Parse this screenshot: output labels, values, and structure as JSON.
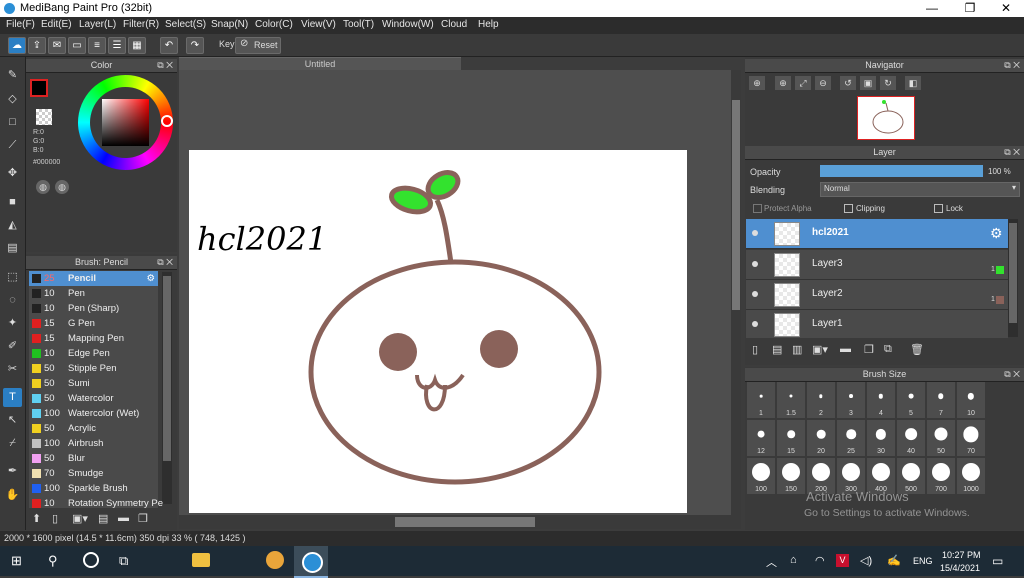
{
  "window": {
    "title": "MediBang Paint Pro (32bit)",
    "minimize": "—",
    "maximize": "❐",
    "close": "✕"
  },
  "menu": [
    "File(F)",
    "Edit(E)",
    "Layer(L)",
    "Filter(R)",
    "Select(S)",
    "Snap(N)",
    "Color(C)",
    "View(V)",
    "Tool(T)",
    "Window(W)",
    "Cloud",
    "Help"
  ],
  "toolbar": {
    "key_label": "Key",
    "reset_label": "Reset"
  },
  "color_panel": {
    "title": "Color",
    "r": "R:0",
    "g": "G:0",
    "b": "B:0",
    "hex": "#000000",
    "foreground": "#000000"
  },
  "brush_panel": {
    "title": "Brush: Pencil",
    "items": [
      {
        "size": "25",
        "name": "Pencil",
        "color": "#222222",
        "selected": true
      },
      {
        "size": "10",
        "name": "Pen",
        "color": "#222222"
      },
      {
        "size": "10",
        "name": "Pen (Sharp)",
        "color": "#222222"
      },
      {
        "size": "15",
        "name": "G Pen",
        "color": "#e02020"
      },
      {
        "size": "15",
        "name": "Mapping Pen",
        "color": "#e02020"
      },
      {
        "size": "10",
        "name": "Edge Pen",
        "color": "#20c020"
      },
      {
        "size": "50",
        "name": "Stipple Pen",
        "color": "#f0d020"
      },
      {
        "size": "50",
        "name": "Sumi",
        "color": "#f0d020"
      },
      {
        "size": "50",
        "name": "Watercolor",
        "color": "#60d0f0"
      },
      {
        "size": "100",
        "name": "Watercolor (Wet)",
        "color": "#60d0f0"
      },
      {
        "size": "50",
        "name": "Acrylic",
        "color": "#f0d020"
      },
      {
        "size": "100",
        "name": "Airbrush",
        "color": "#c0c0c0"
      },
      {
        "size": "50",
        "name": "Blur",
        "color": "#f0a0f0"
      },
      {
        "size": "70",
        "name": "Smudge",
        "color": "#f0e0b0"
      },
      {
        "size": "100",
        "name": "Sparkle Brush",
        "color": "#2060f0"
      },
      {
        "size": "10",
        "name": "Rotation Symmetry Pe",
        "color": "#e02020"
      }
    ]
  },
  "document": {
    "tab": "Untitled",
    "canvas_text": "hcl2021"
  },
  "navigator": {
    "title": "Navigator"
  },
  "layer_panel": {
    "title": "Layer",
    "opacity_label": "Opacity",
    "opacity_value": "100 %",
    "opacity_fraction": 1.0,
    "blending_label": "Blending",
    "blending_value": "Normal",
    "protect_alpha": "Protect Alpha",
    "clipping": "Clipping",
    "lock": "Lock",
    "layers": [
      {
        "name": "hcl2021",
        "selected": true,
        "badge": ""
      },
      {
        "name": "Layer3",
        "selected": false,
        "badge": "1"
      },
      {
        "name": "Layer2",
        "selected": false,
        "badge": "1"
      },
      {
        "name": "Layer1",
        "selected": false,
        "badge": ""
      }
    ]
  },
  "brush_size_panel": {
    "title": "Brush Size",
    "sizes": [
      "1",
      "1.5",
      "2",
      "3",
      "4",
      "5",
      "7",
      "10",
      "12",
      "15",
      "20",
      "25",
      "30",
      "40",
      "50",
      "70",
      "100",
      "150",
      "200",
      "300",
      "400",
      "500",
      "700",
      "1000"
    ]
  },
  "watermark": {
    "line1": "Activate Windows",
    "line2": "Go to Settings to activate Windows."
  },
  "status": {
    "text": "2000 * 1600 pixel  (14.5 * 11.6cm)  350 dpi  33 %  ( 748, 1425 )"
  },
  "taskbar": {
    "lang": "ENG",
    "time": "10:27 PM",
    "date": "15/4/2021"
  }
}
